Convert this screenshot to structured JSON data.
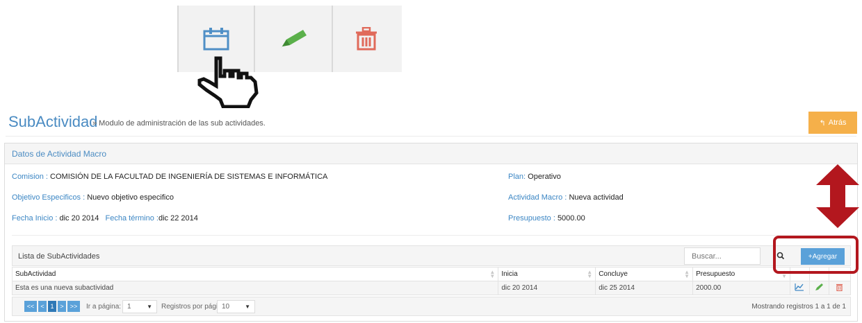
{
  "zoom_toolbar": {
    "icons": [
      "calendar-icon",
      "pencil-icon",
      "trash-icon"
    ]
  },
  "header": {
    "title": "SubActividad",
    "subtitle": "» Modulo de administración de las sub actividades.",
    "back_label": "Atrás"
  },
  "panel": {
    "title": "Datos de Actividad Macro",
    "comision_label": "Comision :",
    "comision_value": "COMISIÓN DE LA FACULTAD DE INGENIERÍA DE SISTEMAS E INFORMÁTICA",
    "objetivo_label": "Objetivo Especificos :",
    "objetivo_value": "Nuevo objetivo especifico",
    "fecha_inicio_label": "Fecha Inicio :",
    "fecha_inicio_value": "dic 20 2014",
    "fecha_termino_label": "Fecha término :",
    "fecha_termino_value": "dic 22 2014",
    "plan_label": "Plan:",
    "plan_value": "Operativo",
    "actividad_label": "Actividad Macro :",
    "actividad_value": "Nueva actividad",
    "presupuesto_label": "Presupuesto :",
    "presupuesto_value": "5000.00"
  },
  "list": {
    "title": "Lista de SubActividades",
    "search_placeholder": "Buscar...",
    "add_label": "+Agregar",
    "columns": [
      "SubActividad",
      "Inicia",
      "Concluye",
      "Presupuesto"
    ],
    "rows": [
      {
        "subactividad": "Esta es una nueva subactividad",
        "inicia": "dic 20 2014",
        "concluye": "dic 25 2014",
        "presupuesto": "2000.00"
      }
    ]
  },
  "pager": {
    "first": "<<",
    "prev": "<",
    "page": "1",
    "next": ">",
    "last": ">>",
    "goto_label": "Ir a página:",
    "goto_value": "1",
    "per_page_label": "Registros por página:",
    "per_page_value": "10",
    "showing": "Mostrando registros 1 a 1 de 1"
  },
  "colors": {
    "accent": "#5aa1d9",
    "label_blue": "#3b86c4",
    "back_button": "#f5b04a",
    "annotation_red": "#b3171e"
  }
}
